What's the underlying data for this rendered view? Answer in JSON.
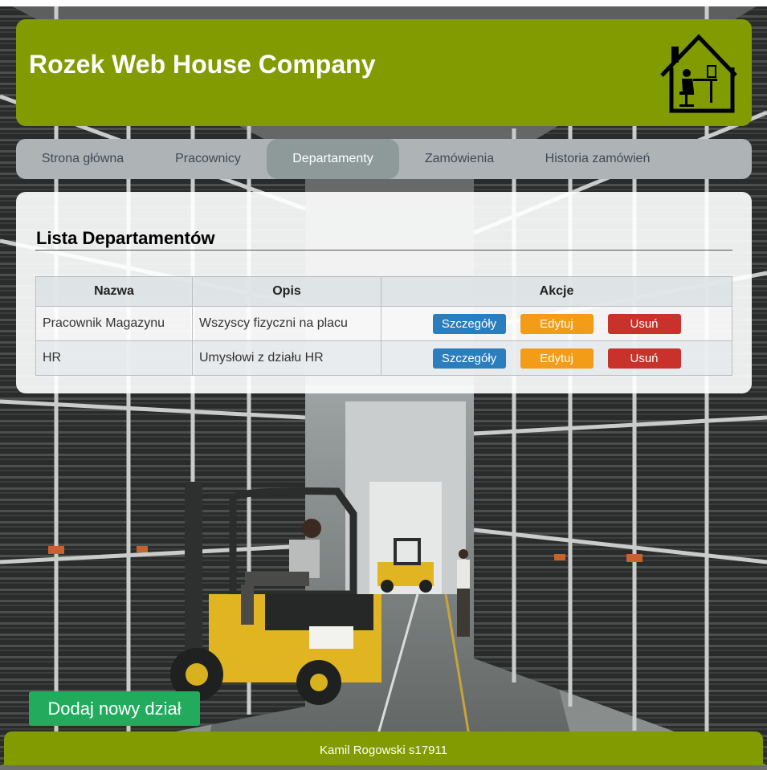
{
  "header": {
    "title": "Rozek Web House Company",
    "logo_icon": "house-with-office-worker-icon",
    "background_color": "#819b00"
  },
  "nav": {
    "items": [
      {
        "label": "Strona główna",
        "active": false
      },
      {
        "label": "Pracownicy",
        "active": false
      },
      {
        "label": "Departamenty",
        "active": true
      },
      {
        "label": "Zamówienia",
        "active": false
      },
      {
        "label": "Historia zamówień",
        "active": false
      }
    ]
  },
  "main": {
    "title": "Lista Departamentów",
    "table": {
      "headers": [
        "Nazwa",
        "Opis",
        "Akcje"
      ],
      "rows": [
        {
          "name": "Pracownik Magazynu",
          "description": "Wszyscy fizyczni na placu"
        },
        {
          "name": "HR",
          "description": "Umysłowi z działu HR"
        }
      ]
    },
    "actions": {
      "details_label": "Szczegóły",
      "edit_label": "Edytuj",
      "delete_label": "Usuń",
      "details_color": "#2b7ebd",
      "edit_color": "#f29c17",
      "delete_color": "#c8322a"
    }
  },
  "add_button": {
    "label": "Dodaj nowy dział",
    "color": "#22ab5d"
  },
  "footer": {
    "text": "Kamil Rogowski s17911"
  },
  "background": {
    "image": "warehouse-with-forklift-and-tire-racks"
  }
}
